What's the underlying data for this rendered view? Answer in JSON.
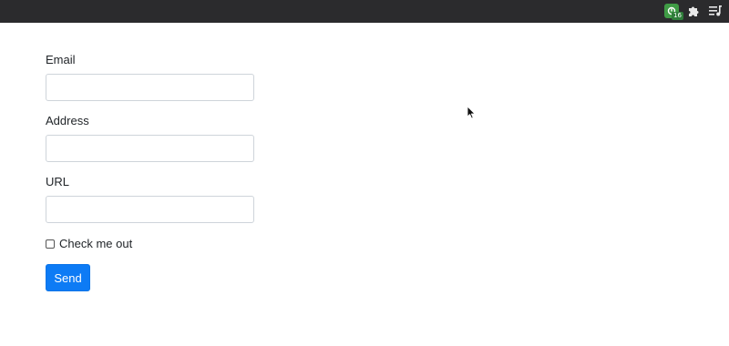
{
  "browser_bar": {
    "extension_badge": "16",
    "icons": [
      "extension-green-icon",
      "puzzle-icon",
      "media-queue-icon"
    ],
    "background_color": "#2b2b2d"
  },
  "form": {
    "email": {
      "label": "Email",
      "value": "",
      "placeholder": ""
    },
    "address": {
      "label": "Address",
      "value": "",
      "placeholder": ""
    },
    "url": {
      "label": "URL",
      "value": "",
      "placeholder": ""
    },
    "checkbox": {
      "label": "Check me out",
      "checked": false
    },
    "submit": {
      "label": "Send",
      "color": "#0d7bf5"
    }
  }
}
